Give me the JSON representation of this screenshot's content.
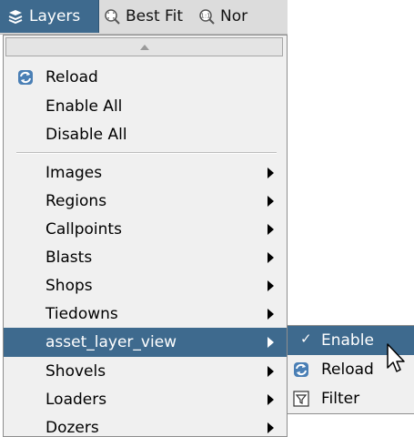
{
  "toolbar": {
    "layers_label": "Layers",
    "bestfit_label": "Best Fit",
    "normal_label": "Nor"
  },
  "menu": {
    "top_items": [
      {
        "label": "Reload",
        "icon": "reload-icon"
      },
      {
        "label": "Enable All"
      },
      {
        "label": "Disable All"
      }
    ],
    "layer_items": [
      {
        "label": "Images"
      },
      {
        "label": "Regions"
      },
      {
        "label": "Callpoints"
      },
      {
        "label": "Blasts"
      },
      {
        "label": "Shops"
      },
      {
        "label": "Tiedowns"
      },
      {
        "label": "asset_layer_view",
        "highlighted": true
      },
      {
        "label": "Shovels"
      },
      {
        "label": "Loaders"
      },
      {
        "label": "Dozers"
      }
    ]
  },
  "submenu": {
    "items": [
      {
        "label": "Enable",
        "icon": "check-icon",
        "highlighted": true
      },
      {
        "label": "Reload",
        "icon": "reload-icon"
      },
      {
        "label": "Filter",
        "icon": "filter-icon"
      }
    ]
  },
  "colors": {
    "highlight": "#3e6a8e",
    "menu_bg": "#f0f0f0",
    "toolbar_bg": "#dcdcdc"
  }
}
